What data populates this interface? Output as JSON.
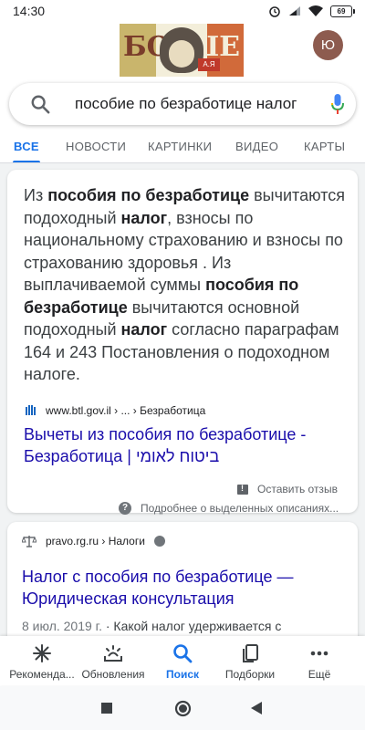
{
  "status_bar": {
    "time": "14:30",
    "battery": "69"
  },
  "header": {
    "doodle": {
      "left_letters": "БО",
      "right_letters": "ШЕ",
      "tag": "А.Я"
    },
    "avatar_initial": "Ю"
  },
  "search": {
    "query": "пособие по безработице налог"
  },
  "tabs": [
    "ВСЕ",
    "НОВОСТИ",
    "КАРТИНКИ",
    "ВИДЕО",
    "КАРТЫ"
  ],
  "featured_snippet": {
    "parts": [
      {
        "t": "Из ",
        "b": false
      },
      {
        "t": "пособия по безработице",
        "b": true
      },
      {
        "t": " вычитаются подоходный ",
        "b": false
      },
      {
        "t": "налог",
        "b": true
      },
      {
        "t": ", взносы по национальному страхованию и взносы по страхованию здоровья . Из выплачиваемой суммы ",
        "b": false
      },
      {
        "t": "пособия по безработице",
        "b": true
      },
      {
        "t": " вычитаются основной подоходный ",
        "b": false
      },
      {
        "t": "налог",
        "b": true
      },
      {
        "t": " согласно параграфам 164 и 243 Постановления о подоходном налоге.",
        "b": false
      }
    ],
    "source": "www.btl.gov.il › ... › Безработица",
    "link_line1": "Вычеты из пособия по безработице -",
    "link_line2": "Безработица | ביטוח לאומי",
    "feedback": "Оставить отзыв",
    "more": "Подробнее о выделенных описаниях..."
  },
  "result2": {
    "source": "pravo.rg.ru › Налоги",
    "title_line1": "Налог с пособия по безработице —",
    "title_line2": "Юридическая консультация",
    "date": "8 июл. 2019 г.",
    "snippet": " · Какой налог удерживается с"
  },
  "bottom_nav": [
    "Рекоменда...",
    "Обновления",
    "Поиск",
    "Подборки",
    "Ещё"
  ],
  "colors": {
    "accent": "#1a73e8",
    "link": "#1a0dab",
    "background": "#f1f3f4"
  }
}
